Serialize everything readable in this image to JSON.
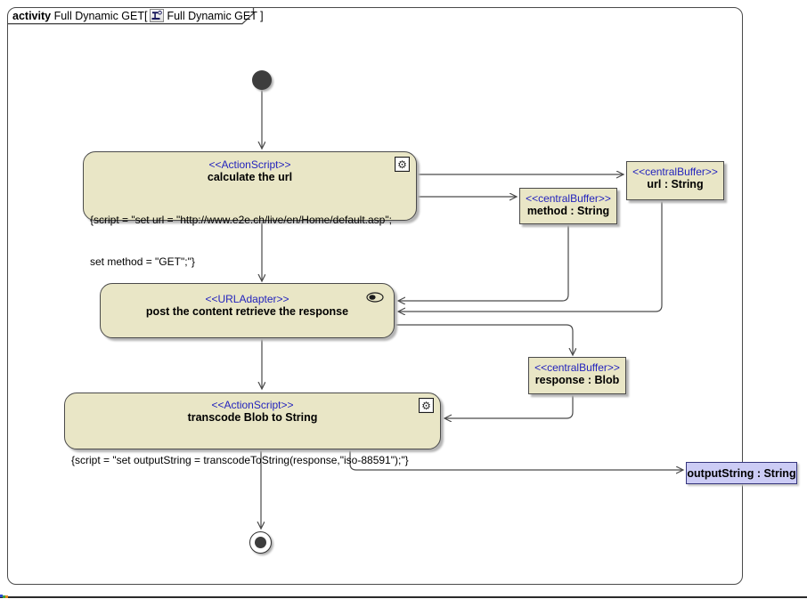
{
  "frame": {
    "keyword": "activity",
    "title_prefix": "Full Dynamic GET[",
    "title_suffix": "Full Dynamic GET ]"
  },
  "icons": {
    "action_icon": "⚙",
    "diagram_icon": "activity-diagram-icon",
    "adapter_icon": "connector-icon"
  },
  "colors": {
    "node_fill": "#e9e6c6",
    "node_border": "#4a4a4a",
    "stereotype_blue": "#2323bd",
    "param_fill": "#ccccf5",
    "edge": "#4a4a4a"
  },
  "nodes": {
    "action_calculate": {
      "stereotype": "<<ActionScript>>",
      "name": "calculate the url",
      "script_line1": "{script = \"set url = \"http://www.e2e.ch/live/en/Home/default.asp\";",
      "script_line2": "set method = \"GET\";\"}"
    },
    "buffer_url": {
      "stereotype": "<<centralBuffer>>",
      "name": "url : String"
    },
    "buffer_method": {
      "stereotype": "<<centralBuffer>>",
      "name": "method : String"
    },
    "adapter_post": {
      "stereotype": "<<URLAdapter>>",
      "name": "post the content retrieve the response"
    },
    "buffer_response": {
      "stereotype": "<<centralBuffer>>",
      "name": "response : Blob"
    },
    "action_transcode": {
      "stereotype": "<<ActionScript>>",
      "name": "transcode Blob to String",
      "script_line1": "{script = \"set outputString = transcodeToString(response,\"iso-88591\");\"}"
    },
    "param_output": {
      "name": "outputString : String"
    }
  }
}
